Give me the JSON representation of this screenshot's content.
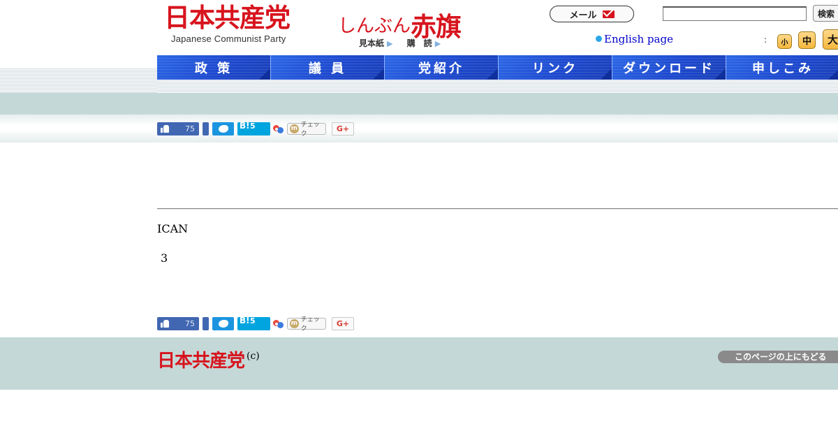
{
  "header": {
    "jcp_logo": "日本共産党",
    "jcp_logo_en": "Japanese Communist Party",
    "akahata_hiragana": "しんぶん",
    "akahata_kanji": "赤旗",
    "sample_label": "見本紙",
    "subscribe_label": "購　読",
    "mail_label": "メール",
    "search_placeholder": "",
    "search_button": "検索",
    "english_link": "English page",
    "font_size_separator": ":",
    "font_small": "小",
    "font_medium": "中",
    "font_large": "大"
  },
  "nav": {
    "items": [
      "政 策",
      "議 員",
      "党紹介",
      "リンク",
      "ダウンロード",
      "申しこみ"
    ]
  },
  "share": {
    "like_count": "75",
    "hatena_label": "B!",
    "hatena_count": "5",
    "mixi_label": "チェック",
    "gplus_label": "G+"
  },
  "article": {
    "title": "ICAN",
    "date": "3"
  },
  "footer": {
    "logo": "日本共産党",
    "copyright": "(c)",
    "page_top": "このページの上にもどる"
  }
}
